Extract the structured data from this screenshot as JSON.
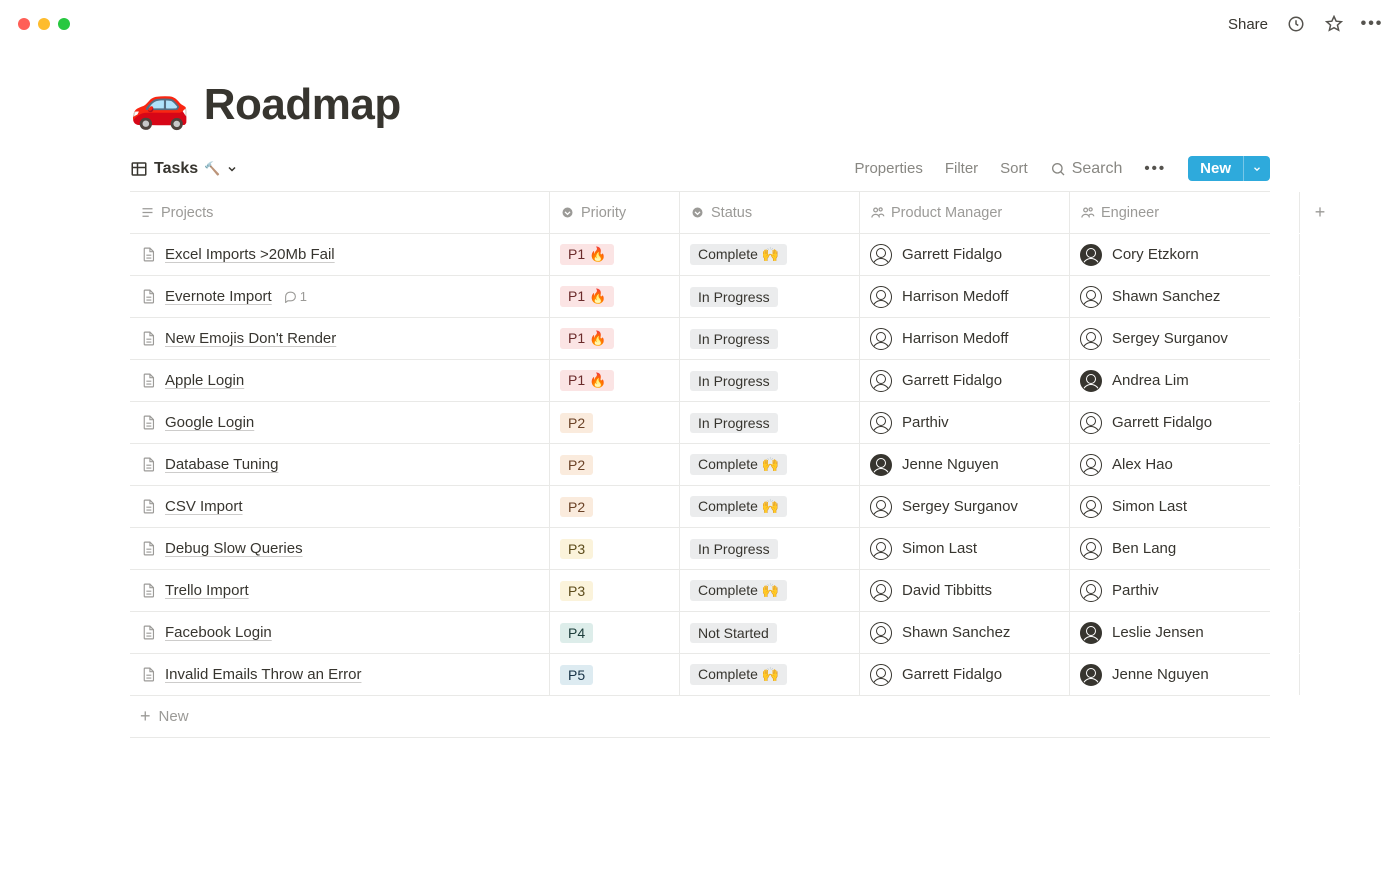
{
  "window": {
    "share_label": "Share"
  },
  "page": {
    "emoji": "🚗",
    "title": "Roadmap"
  },
  "view": {
    "name": "Tasks",
    "view_emoji": "🔨",
    "properties_label": "Properties",
    "filter_label": "Filter",
    "sort_label": "Sort",
    "search_label": "Search",
    "new_label": "New"
  },
  "columns": {
    "projects": "Projects",
    "priority": "Priority",
    "status": "Status",
    "pm": "Product Manager",
    "engineer": "Engineer"
  },
  "priority_styles": {
    "P1 🔥": "tag-p1",
    "P2": "tag-p2",
    "P3": "tag-p3",
    "P4": "tag-p4",
    "P5": "tag-p5"
  },
  "rows": [
    {
      "title": "Excel Imports >20Mb Fail",
      "comments": null,
      "priority": "P1 🔥",
      "status": "Complete 🙌",
      "pm": "Garrett Fidalgo",
      "engineer": "Cory Etzkorn",
      "pm_dark": false,
      "eng_dark": true
    },
    {
      "title": "Evernote Import",
      "comments": 1,
      "priority": "P1 🔥",
      "status": "In Progress",
      "pm": "Harrison Medoff",
      "engineer": "Shawn Sanchez",
      "pm_dark": false,
      "eng_dark": false
    },
    {
      "title": "New Emojis Don't Render",
      "comments": null,
      "priority": "P1 🔥",
      "status": "In Progress",
      "pm": "Harrison Medoff",
      "engineer": "Sergey Surganov",
      "pm_dark": false,
      "eng_dark": false
    },
    {
      "title": "Apple Login",
      "comments": null,
      "priority": "P1 🔥",
      "status": "In Progress",
      "pm": "Garrett Fidalgo",
      "engineer": "Andrea Lim",
      "pm_dark": false,
      "eng_dark": true
    },
    {
      "title": "Google Login",
      "comments": null,
      "priority": "P2",
      "status": "In Progress",
      "pm": "Parthiv",
      "engineer": "Garrett Fidalgo",
      "pm_dark": false,
      "eng_dark": false
    },
    {
      "title": "Database Tuning",
      "comments": null,
      "priority": "P2",
      "status": "Complete 🙌",
      "pm": "Jenne Nguyen",
      "engineer": "Alex Hao",
      "pm_dark": true,
      "eng_dark": false
    },
    {
      "title": "CSV Import",
      "comments": null,
      "priority": "P2",
      "status": "Complete 🙌",
      "pm": "Sergey Surganov",
      "engineer": "Simon Last",
      "pm_dark": false,
      "eng_dark": false
    },
    {
      "title": "Debug Slow Queries",
      "comments": null,
      "priority": "P3",
      "status": "In Progress",
      "pm": "Simon Last",
      "engineer": "Ben Lang",
      "pm_dark": false,
      "eng_dark": false
    },
    {
      "title": "Trello Import",
      "comments": null,
      "priority": "P3",
      "status": "Complete 🙌",
      "pm": "David Tibbitts",
      "engineer": "Parthiv",
      "pm_dark": false,
      "eng_dark": false
    },
    {
      "title": "Facebook Login",
      "comments": null,
      "priority": "P4",
      "status": "Not Started",
      "pm": "Shawn Sanchez",
      "engineer": "Leslie Jensen",
      "pm_dark": false,
      "eng_dark": true
    },
    {
      "title": "Invalid Emails Throw an Error",
      "comments": null,
      "priority": "P5",
      "status": "Complete 🙌",
      "pm": "Garrett Fidalgo",
      "engineer": "Jenne Nguyen",
      "pm_dark": false,
      "eng_dark": true
    }
  ],
  "new_row_label": "New"
}
